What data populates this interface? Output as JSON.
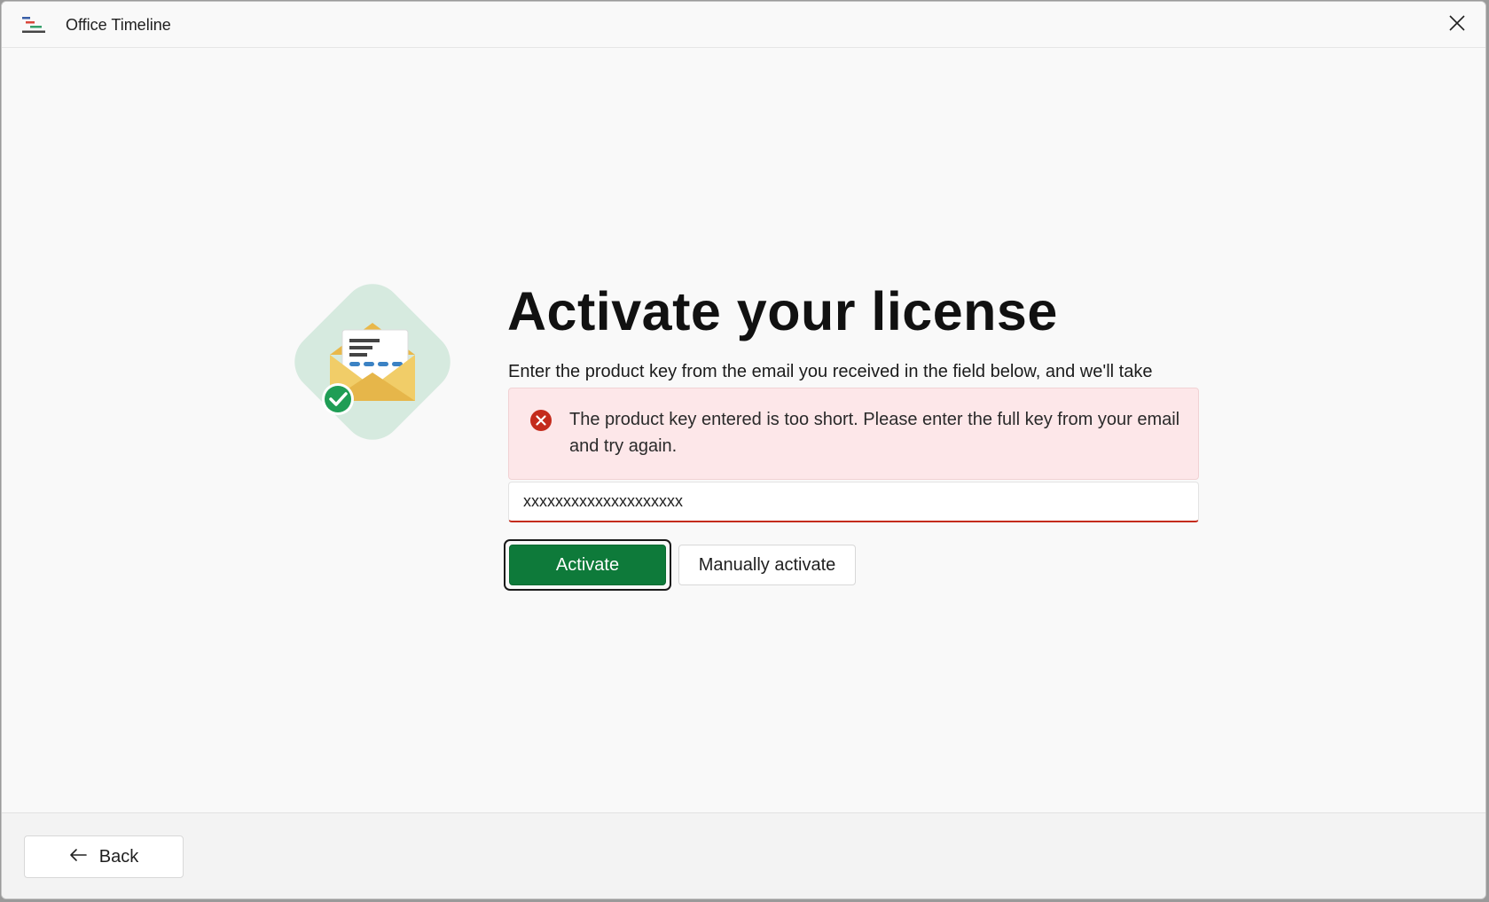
{
  "window": {
    "title": "Office Timeline",
    "app_icon": "office-timeline-logo-icon",
    "close_icon": "close-icon"
  },
  "main": {
    "illustration": "envelope-check-icon",
    "heading": "Activate your license",
    "description": "Enter the product key from the email you received in the field below, and we'll take",
    "error": {
      "icon": "error-circle-icon",
      "message": "The product key entered is too short. Please enter the full key from your email and try again.",
      "color": "#c42b1c",
      "background": "#fde7e9"
    },
    "product_key": {
      "value": "xxxxxxxxxxxxxxxxxxxx"
    },
    "buttons": {
      "activate_label": "Activate",
      "manual_label": "Manually activate"
    },
    "accent_color": "#0e7a3a"
  },
  "footer": {
    "back_label": "Back",
    "back_icon": "arrow-left-icon"
  }
}
